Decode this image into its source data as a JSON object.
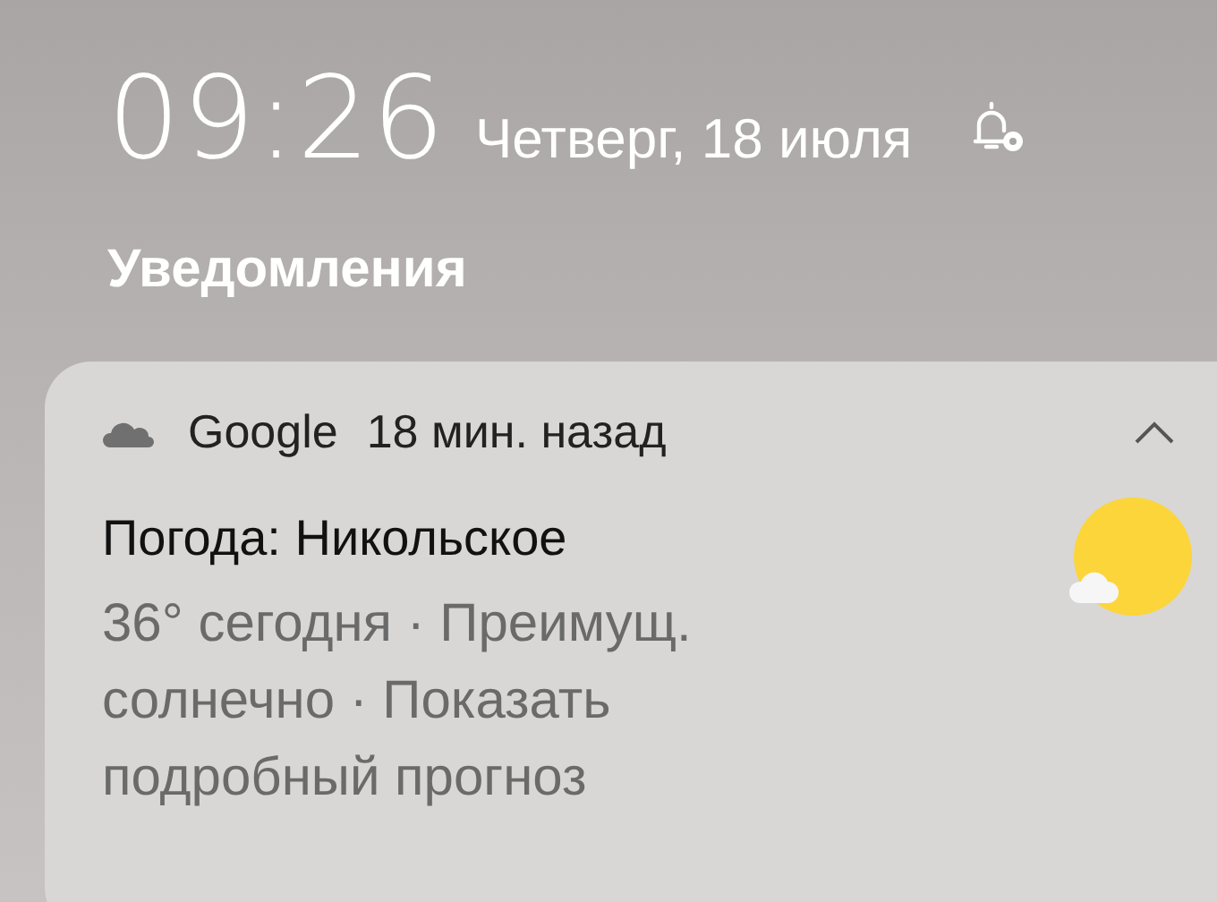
{
  "lock_screen": {
    "time": "09:26",
    "date": "Четверг, 18 июля"
  },
  "section_title": "Уведомления",
  "notification": {
    "app": "Google",
    "time_ago": "18 мин. назад",
    "title": "Погода: Никольское",
    "body": "36° сегодня · Преимущ. солнечно · Показать подробный прогноз"
  }
}
